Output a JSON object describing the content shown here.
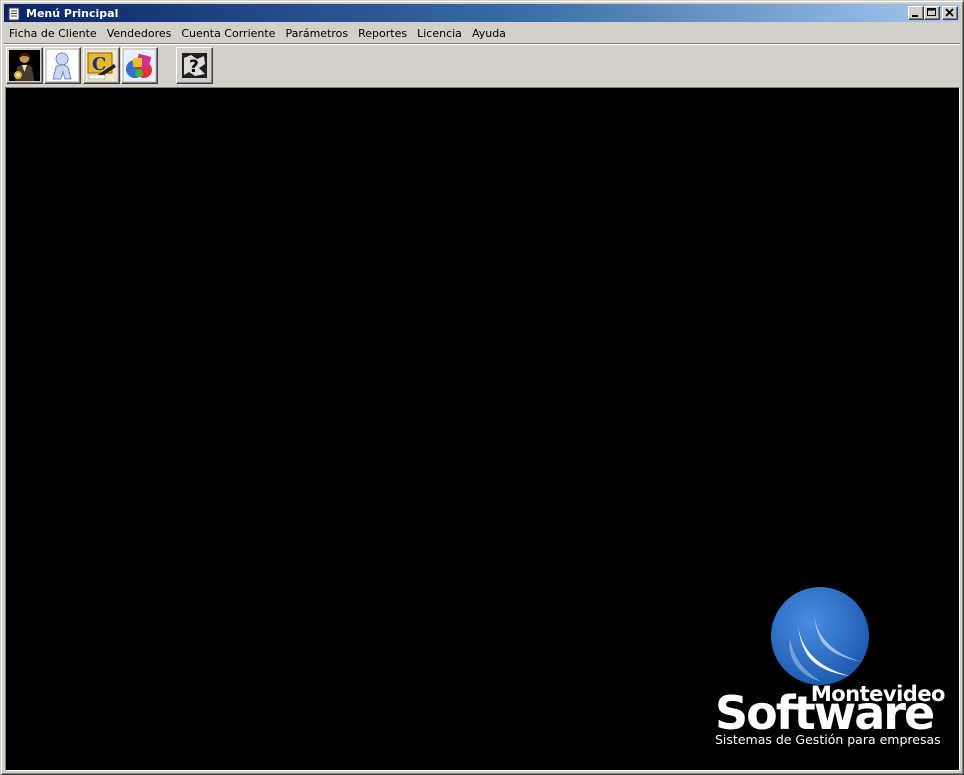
{
  "window": {
    "title": "Menú Principal",
    "icon": "document-icon",
    "controls": {
      "minimize": "minimize-icon",
      "maximize": "maximize-icon",
      "close": "close-icon"
    }
  },
  "menubar": {
    "items": [
      {
        "label": "Ficha de Cliente"
      },
      {
        "label": "Vendedores"
      },
      {
        "label": "Cuenta Corriente"
      },
      {
        "label": "Parámetros"
      },
      {
        "label": "Reportes"
      },
      {
        "label": "Licencia"
      },
      {
        "label": "Ayuda"
      }
    ]
  },
  "toolbar": {
    "buttons": [
      {
        "icon": "client-person-icon"
      },
      {
        "icon": "seller-person-icon"
      },
      {
        "icon": "account-icon"
      },
      {
        "icon": "parameters-icon"
      },
      {
        "icon": "help-icon"
      }
    ]
  },
  "logo": {
    "line1": "Montevideo",
    "line2": "Software",
    "tagline": "Sistemas de Gestión para empresas"
  },
  "colors": {
    "titlebar_start": "#0a246a",
    "titlebar_end": "#a6caf0",
    "chrome": "#d4d0c8",
    "workspace": "#000000",
    "logo_blue": "#2a6cc0"
  }
}
